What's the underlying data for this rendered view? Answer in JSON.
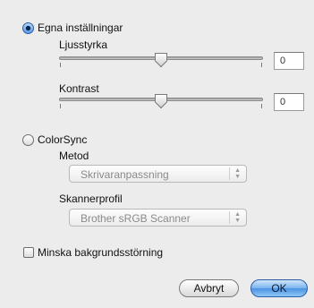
{
  "mode_custom": {
    "label": "Egna inställningar",
    "selected": true
  },
  "brightness": {
    "label": "Ljusstyrka",
    "value": "0"
  },
  "contrast": {
    "label": "Kontrast",
    "value": "0"
  },
  "mode_colorsync": {
    "label": "ColorSync",
    "selected": false
  },
  "method": {
    "label": "Metod",
    "selected": "Skrivaranpassning"
  },
  "scanner_profile": {
    "label": "Skannerprofil",
    "selected": "Brother sRGB Scanner"
  },
  "reduce_noise": {
    "label": "Minska bakgrundsstörning",
    "checked": false
  },
  "buttons": {
    "cancel": "Avbryt",
    "ok": "OK"
  },
  "icons": {
    "popup_arrows": "up-down-arrows-icon",
    "slider_thumb": "slider-thumb-icon"
  }
}
